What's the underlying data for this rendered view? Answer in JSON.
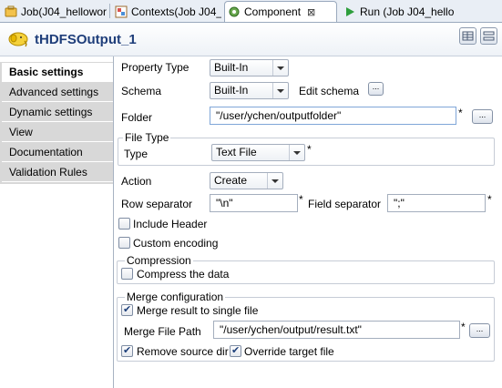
{
  "tabs": [
    {
      "label": "Job(J04_helloworl",
      "icon": "job-icon",
      "active": false
    },
    {
      "label": "Contexts(Job J04_",
      "icon": "contexts-icon",
      "active": false
    },
    {
      "label": "Component",
      "icon": "component-icon",
      "active": true,
      "close": "⊠"
    },
    {
      "label": "Run (Job J04_hello",
      "icon": "run-icon",
      "active": false
    }
  ],
  "header": {
    "title": "tHDFSOutput_1"
  },
  "nav": [
    "Basic settings",
    "Advanced settings",
    "Dynamic settings",
    "View",
    "Documentation",
    "Validation Rules"
  ],
  "form": {
    "property_type": {
      "label": "Property Type",
      "value": "Built-In"
    },
    "schema": {
      "label": "Schema",
      "value": "Built-In",
      "edit_label": "Edit schema",
      "btn": "..."
    },
    "folder": {
      "label": "Folder",
      "value": "\"/user/ychen/outputfolder\"",
      "star": "*",
      "btn": "..."
    },
    "file_type": {
      "group": "File Type",
      "label": "Type",
      "value": "Text File",
      "star": "*"
    },
    "action": {
      "label": "Action",
      "value": "Create"
    },
    "row_separator": {
      "label": "Row separator",
      "value": "\"\\n\"",
      "star": "*"
    },
    "field_separator": {
      "label": "Field separator",
      "value": "\";\"",
      "star": "*"
    },
    "include_header": {
      "label": "Include Header",
      "checked": false
    },
    "custom_encoding": {
      "label": "Custom encoding",
      "checked": false
    },
    "compression": {
      "group": "Compression",
      "label": "Compress the data",
      "checked": false
    },
    "merge": {
      "group": "Merge configuration",
      "merge_single": {
        "label": "Merge result to single file",
        "checked": true
      },
      "path_label": "Merge File Path",
      "path_value": "\"/user/ychen/output/result.txt\"",
      "star": "*",
      "btn": "...",
      "remove_source": {
        "label": "Remove source dir",
        "checked": true
      },
      "override_target": {
        "label": "Override target file",
        "checked": true
      }
    }
  }
}
